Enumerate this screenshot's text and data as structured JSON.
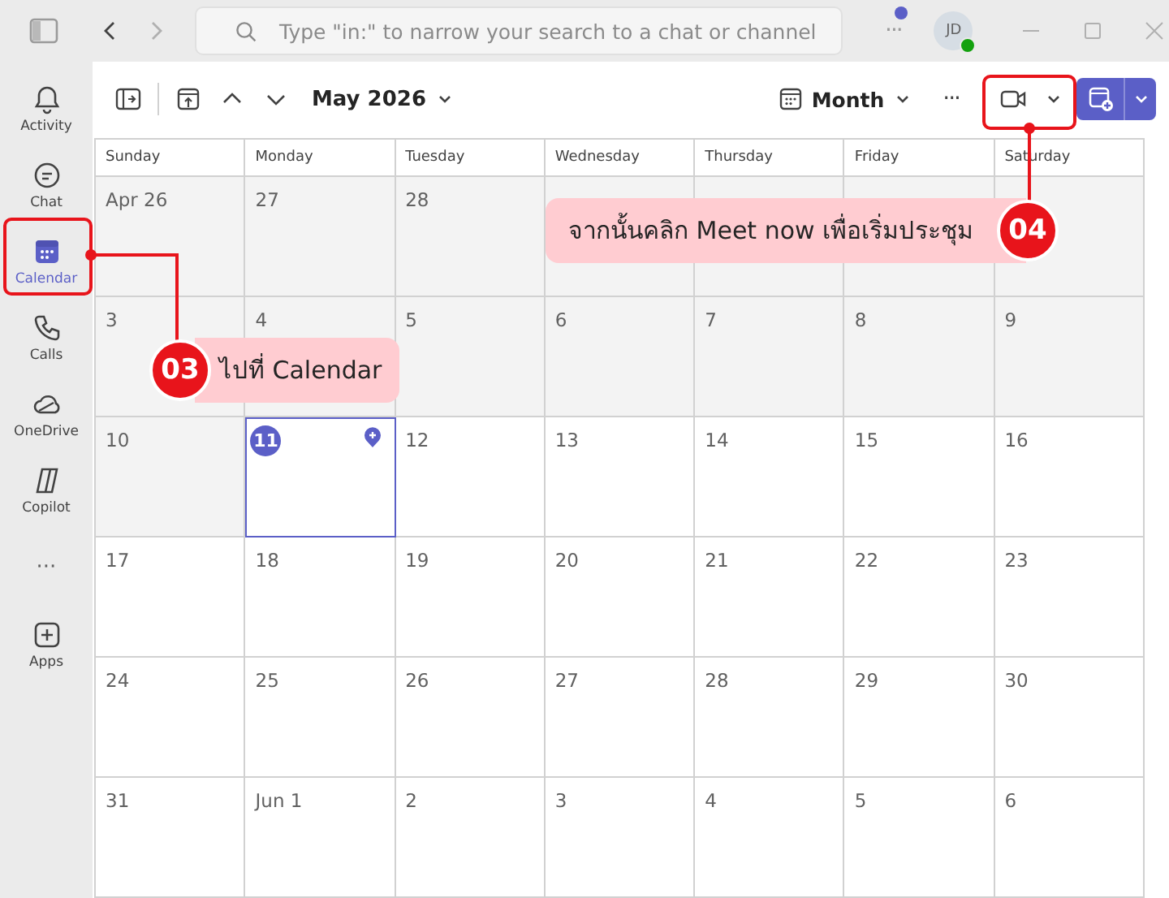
{
  "title_bar": {
    "search_placeholder": "Type \"in:\" to narrow your search to a chat or channel",
    "more": "···",
    "has_notification": true,
    "avatar": "JD",
    "online": true
  },
  "sidebar": {
    "items": [
      {
        "kind": "app",
        "label": "Activity",
        "selected": false
      },
      {
        "kind": "app",
        "label": "Chat",
        "selected": false
      },
      {
        "kind": "app",
        "label": "Calendar",
        "selected": true
      },
      {
        "kind": "app",
        "label": "Calls",
        "selected": false
      },
      {
        "kind": "app",
        "label": "OneDrive",
        "selected": false
      },
      {
        "kind": "app",
        "label": "Copilot",
        "selected": false
      },
      {
        "kind": "more",
        "label": "···",
        "selected": false
      },
      {
        "kind": "app",
        "label": "Apps",
        "selected": false
      }
    ]
  },
  "toolbar": {
    "month": "May 2026",
    "view": "Month",
    "more": "···"
  },
  "calendar": {
    "weekdays": [
      "Sunday",
      "Monday",
      "Tuesday",
      "Wednesday",
      "Thursday",
      "Friday",
      "Saturday"
    ],
    "weeks": [
      [
        {
          "label": "Apr 26",
          "past": true,
          "today": false
        },
        {
          "label": "27",
          "past": true,
          "today": false
        },
        {
          "label": "28",
          "past": true,
          "today": false
        },
        {
          "past": true,
          "today": false
        },
        {
          "past": true,
          "today": false
        },
        {
          "past": true,
          "today": false
        },
        {
          "past": true,
          "today": false
        }
      ],
      [
        {
          "label": "3",
          "past": true,
          "today": false
        },
        {
          "label": "4",
          "past": true,
          "today": false
        },
        {
          "label": "5",
          "past": true,
          "today": false
        },
        {
          "label": "6",
          "past": true,
          "today": false
        },
        {
          "label": "7",
          "past": true,
          "today": false
        },
        {
          "label": "8",
          "past": true,
          "today": false
        },
        {
          "label": "9",
          "past": true,
          "today": false
        }
      ],
      [
        {
          "label": "10",
          "past": true,
          "today": false
        },
        {
          "label": "11",
          "past": false,
          "today": true
        },
        {
          "label": "12",
          "past": false,
          "today": false
        },
        {
          "label": "13",
          "past": false,
          "today": false
        },
        {
          "label": "14",
          "past": false,
          "today": false
        },
        {
          "label": "15",
          "past": false,
          "today": false
        },
        {
          "label": "16",
          "past": false,
          "today": false
        }
      ],
      [
        {
          "label": "17",
          "past": false,
          "today": false
        },
        {
          "label": "18",
          "past": false,
          "today": false
        },
        {
          "label": "19",
          "past": false,
          "today": false
        },
        {
          "label": "20",
          "past": false,
          "today": false
        },
        {
          "label": "21",
          "past": false,
          "today": false
        },
        {
          "label": "22",
          "past": false,
          "today": false
        },
        {
          "label": "23",
          "past": false,
          "today": false
        }
      ],
      [
        {
          "label": "24",
          "past": false,
          "today": false
        },
        {
          "label": "25",
          "past": false,
          "today": false
        },
        {
          "label": "26",
          "past": false,
          "today": false
        },
        {
          "label": "27",
          "past": false,
          "today": false
        },
        {
          "label": "28",
          "past": false,
          "today": false
        },
        {
          "label": "29",
          "past": false,
          "today": false
        },
        {
          "label": "30",
          "past": false,
          "today": false
        }
      ],
      [
        {
          "label": "31",
          "past": false,
          "today": false
        },
        {
          "label": "Jun 1",
          "past": false,
          "today": false
        },
        {
          "label": "2",
          "past": false,
          "today": false
        },
        {
          "label": "3",
          "past": false,
          "today": false
        },
        {
          "label": "4",
          "past": false,
          "today": false
        },
        {
          "label": "5",
          "past": false,
          "today": false
        },
        {
          "label": "6",
          "past": false,
          "today": false
        }
      ]
    ]
  },
  "annotations": [
    {
      "number": "03",
      "text": "ไปที่ Calendar"
    },
    {
      "number": "04",
      "text": "จากนั้นคลิก Meet now เพื่อเริ่มประชุม"
    }
  ]
}
